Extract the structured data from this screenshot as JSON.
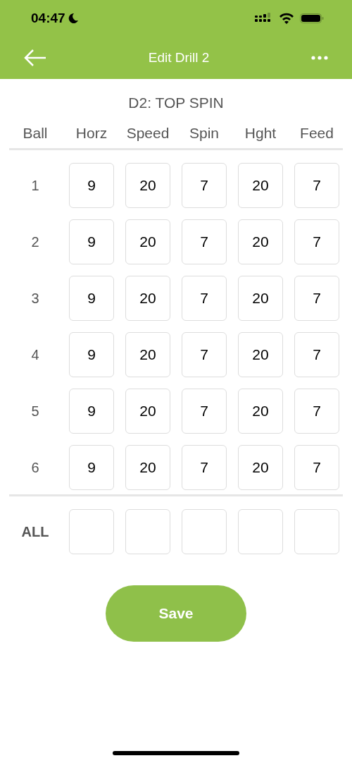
{
  "status_bar": {
    "time": "04:47"
  },
  "nav_bar": {
    "title": "Edit Drill 2"
  },
  "drill_title": "D2: TOP SPIN",
  "table": {
    "columns": [
      "Ball",
      "Horz",
      "Speed",
      "Spin",
      "Hght",
      "Feed"
    ],
    "rows": [
      {
        "ball": "1",
        "values": [
          "9",
          "20",
          "7",
          "20",
          "7"
        ]
      },
      {
        "ball": "2",
        "values": [
          "9",
          "20",
          "7",
          "20",
          "7"
        ]
      },
      {
        "ball": "3",
        "values": [
          "9",
          "20",
          "7",
          "20",
          "7"
        ]
      },
      {
        "ball": "4",
        "values": [
          "9",
          "20",
          "7",
          "20",
          "7"
        ]
      },
      {
        "ball": "5",
        "values": [
          "9",
          "20",
          "7",
          "20",
          "7"
        ]
      },
      {
        "ball": "6",
        "values": [
          "9",
          "20",
          "7",
          "20",
          "7"
        ]
      }
    ],
    "all_row": {
      "label": "ALL",
      "fields": [
        {
          "kind": "input"
        },
        {
          "kind": "input"
        },
        {
          "kind": "input"
        },
        {
          "kind": "input"
        },
        {
          "kind": "input"
        }
      ]
    }
  },
  "buttons": [
    "Save"
  ]
}
